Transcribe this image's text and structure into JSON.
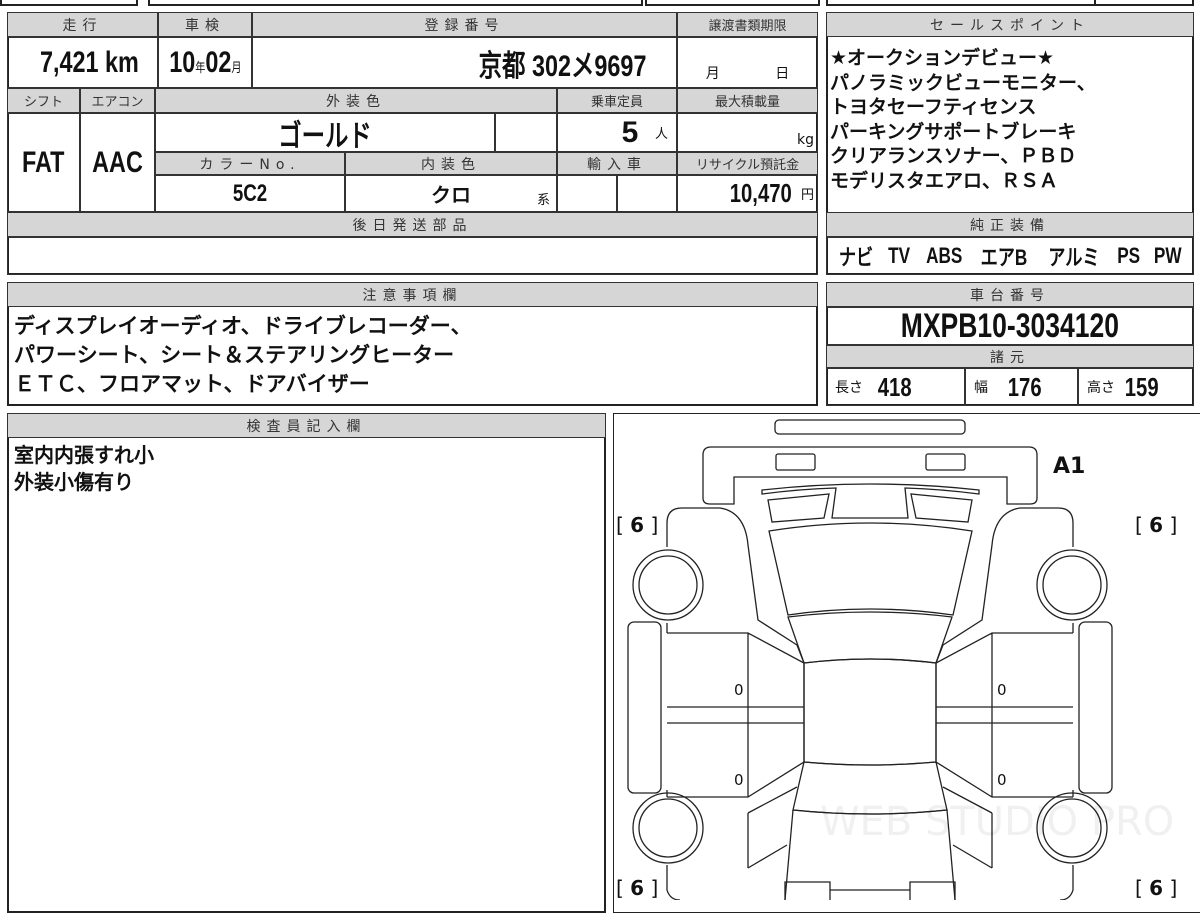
{
  "vehicle": {
    "headers": {
      "mileage": "走行",
      "inspection": "車検",
      "registration": "登録番号",
      "transfer_deadline": "譲渡書類期限",
      "shift": "シフト",
      "aircon": "エアコン",
      "exterior_color": "外装色",
      "capacity": "乗車定員",
      "max_load": "最大積載量",
      "color_no": "カラーNo.",
      "interior_color": "内装色",
      "imported": "輸入車",
      "recycle_fee": "リサイクル預託金",
      "later_parts": "後日発送部品"
    },
    "mileage": "7,421",
    "mileage_unit": "km",
    "inspection_year": "10",
    "year_unit": "年",
    "inspection_month": "02",
    "month_unit": "月",
    "registration": "京都 302メ9697",
    "transfer_month_unit": "月",
    "transfer_day_unit": "日",
    "shift": "FAT",
    "aircon": "AAC",
    "exterior_color": "ゴールド",
    "capacity": "5",
    "capacity_unit": "人",
    "max_load_unit": "kg",
    "color_no": "5C2",
    "interior_color": "クロ",
    "interior_suffix": "系",
    "recycle_fee": "10,470",
    "recycle_unit": "円"
  },
  "sales_points": {
    "header": "セールスポイント",
    "lines": [
      "★オークションデビュー★",
      "パノラミックビューモニター、",
      "トヨタセーフティセンス",
      "パーキングサポートブレーキ",
      "クリアランスソナー、ＰＢＤ",
      "モデリスタエアロ、ＲＳＡ"
    ]
  },
  "equipment": {
    "header": "純正装備",
    "items": [
      "ナビ",
      "TV",
      "ABS",
      "エアB",
      "アルミ",
      "PS",
      "PW"
    ]
  },
  "notes": {
    "header": "注意事項欄",
    "lines": [
      "ディスプレイオーディオ、ドライブレコーダー、",
      "パワーシート、シート＆ステアリングヒーター",
      "ＥＴＣ、フロアマット、ドアバイザー"
    ]
  },
  "chassis": {
    "header": "車台番号",
    "value": "MXPB10-3034120"
  },
  "specs": {
    "header": "諸元",
    "length_label": "長さ",
    "length": "418",
    "width_label": "幅",
    "width": "176",
    "height_label": "高さ",
    "height": "159"
  },
  "inspector": {
    "header": "検査員記入欄",
    "lines": [
      "室内内張すれ小",
      "外装小傷有り"
    ]
  },
  "diagram": {
    "marks": {
      "front": "A1",
      "tire_fl": "6",
      "tire_fr": "6",
      "tire_rl": "6",
      "tire_rr": "6",
      "door_lf": "0",
      "door_lr": "0",
      "door_rf": "0",
      "door_rr": "0"
    },
    "watermark": "WEB STUDIO PRO"
  }
}
